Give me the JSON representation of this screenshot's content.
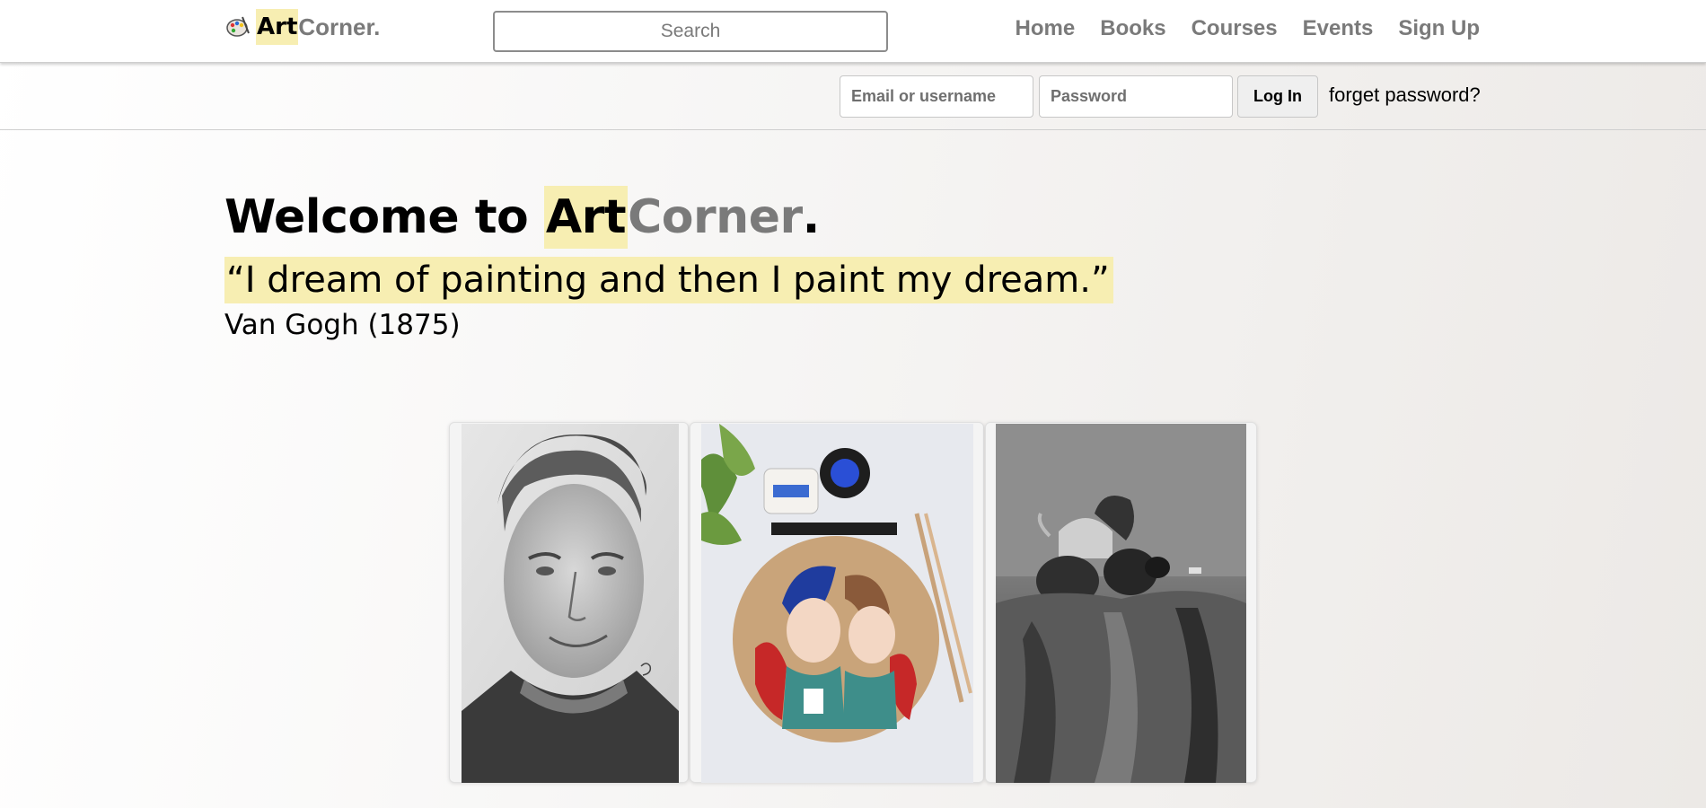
{
  "brand": {
    "art": "Art",
    "corner": "Corner."
  },
  "search": {
    "placeholder": "Search"
  },
  "nav": {
    "items": [
      "Home",
      "Books",
      "Courses",
      "Events",
      "Sign Up"
    ]
  },
  "login": {
    "email_placeholder": "Email or username",
    "password_placeholder": "Password",
    "button_label": "Log In",
    "forget_label": "forget password?"
  },
  "hero": {
    "welcome": "Welcome to ",
    "art": "Art",
    "corner": "Corner",
    "dot": ".",
    "quote": "“I dream of painting and then I paint my dream.”",
    "author": "Van Gogh (1875)"
  },
  "gallery": [
    {
      "subject": "pencil portrait of a young man"
    },
    {
      "subject": "anime illustration on round sketchbook with paint and brushes"
    },
    {
      "subject": "charcoal still life with teapot and fruit on draped cloth"
    }
  ],
  "colors": {
    "highlight": "#f7eeb2",
    "muted_text": "#7a7a7a",
    "nav_bg": "#ffffff"
  }
}
